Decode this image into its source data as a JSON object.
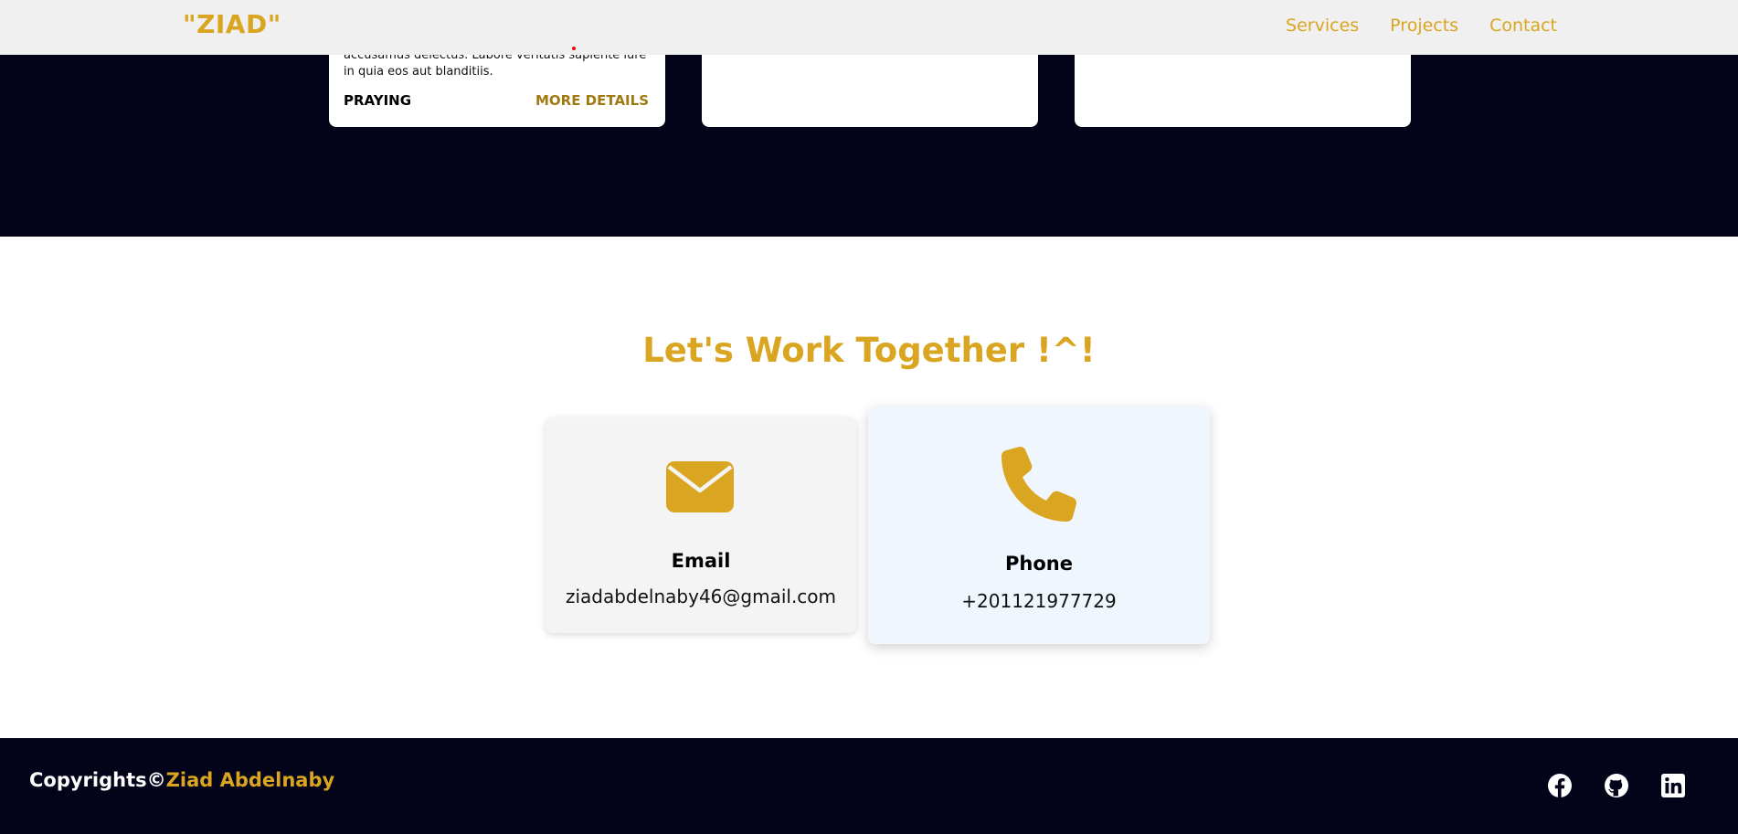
{
  "header": {
    "logo": "\"ZIAD\"",
    "nav": [
      "Services",
      "Projects",
      "Contact"
    ]
  },
  "projects": {
    "card_text": "accusamus delectus. Labore veritatis sapiente iure in quia eos aut blanditiis.",
    "card_tag": "PRAYING",
    "card_more": "MORE DETAILS"
  },
  "contact": {
    "title": "Let's Work Together !^!",
    "email_label": "Email",
    "email_value": "ziadabdelnaby46@gmail.com",
    "phone_label": "Phone",
    "phone_value": "+201121977729"
  },
  "footer": {
    "copyright_prefix": "Copyrights©",
    "copyright_name": "Ziad Abdelnaby",
    "socials": [
      "facebook-icon",
      "github-icon",
      "linkedin-icon"
    ]
  },
  "colors": {
    "accent": "#daa520",
    "dark": "#03031a",
    "header_bg": "#f0f0f0"
  }
}
